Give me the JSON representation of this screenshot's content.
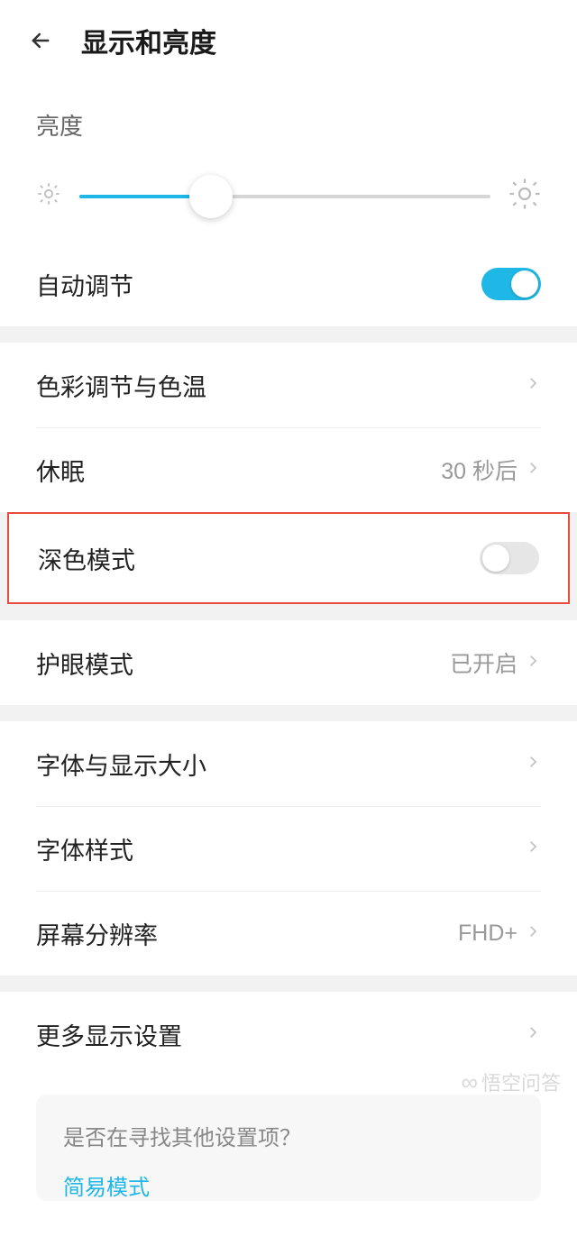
{
  "header": {
    "title": "显示和亮度"
  },
  "brightness": {
    "label": "亮度",
    "percent": 32
  },
  "auto_adjust": {
    "label": "自动调节",
    "enabled": true
  },
  "rows": {
    "color": {
      "label": "色彩调节与色温"
    },
    "sleep": {
      "label": "休眠",
      "value": "30 秒后"
    },
    "dark_mode": {
      "label": "深色模式",
      "enabled": false
    },
    "eye_comfort": {
      "label": "护眼模式",
      "value": "已开启"
    },
    "font_display_size": {
      "label": "字体与显示大小"
    },
    "font_style": {
      "label": "字体样式"
    },
    "resolution": {
      "label": "屏幕分辨率",
      "value": "FHD+"
    },
    "more": {
      "label": "更多显示设置"
    }
  },
  "footer": {
    "question": "是否在寻找其他设置项？",
    "link": "简易模式"
  },
  "watermark": "悟空问答"
}
